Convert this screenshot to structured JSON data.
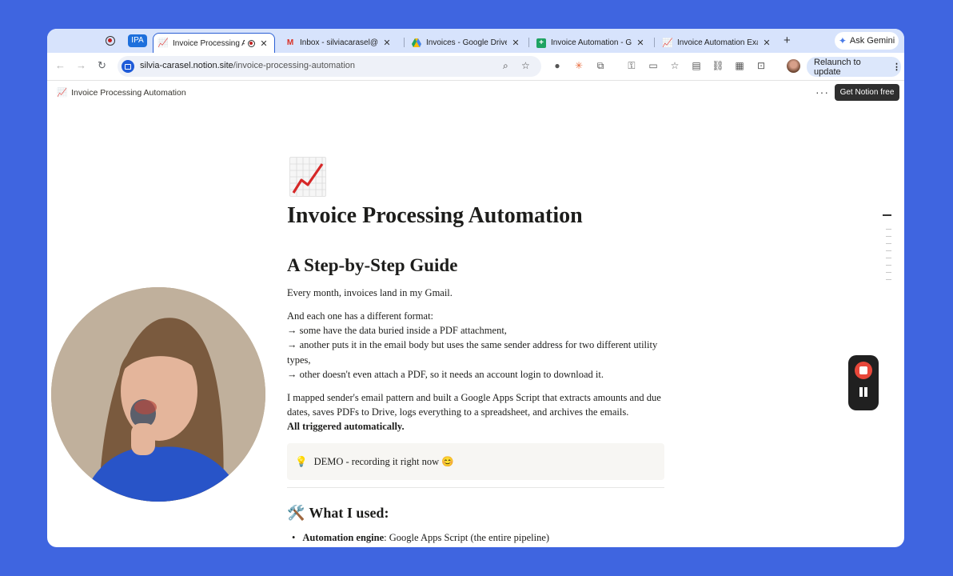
{
  "browser": {
    "group_label": "IPA",
    "tabs": [
      {
        "title": "Invoice Processing Automation",
        "active": true
      },
      {
        "title": "Inbox - silviacarasel@gmail.com"
      },
      {
        "title": "Invoices - Google Drive"
      },
      {
        "title": "Invoice Automation - Google Sheets"
      },
      {
        "title": "Invoice Automation Example"
      }
    ],
    "new_tab": "+",
    "gemini_label": "Ask Gemini",
    "url_host": "silvia-carasel.notion.site",
    "url_path": "/invoice-processing-automation",
    "relaunch_label": "Relaunch to update"
  },
  "notion": {
    "breadcrumb": "Invoice Processing Automation",
    "more": "···",
    "get_notion": "Get Notion free"
  },
  "page": {
    "title": "Invoice Processing Automation",
    "subtitle": "A Step-by-Step Guide",
    "p1": "Every month, invoices land in my Gmail.",
    "p2_lines": [
      "And each one has a different format:",
      "→ some have the data buried inside a PDF attachment,",
      "→ another puts it in the email body but uses the same sender address for two different utility",
      "types,",
      "→ other doesn't even attach a PDF, so it needs an account login to download it."
    ],
    "p3_lines": [
      "I mapped sender's email pattern and built a Google Apps Script that extracts amounts and due",
      "dates, saves PDFs to Drive, logs everything to a spreadsheet, and archives the emails."
    ],
    "p3_bold": "All triggered automatically.",
    "callout_icon": "💡",
    "callout_text": "DEMO - recording it right now 😊",
    "section_icon": "🛠️",
    "section_title": "What I used:",
    "bullets": [
      {
        "bold": "Automation engine",
        "text": ": Google Apps Script (the entire pipeline)"
      }
    ]
  },
  "icons": {
    "page_icon": "chart-increasing-icon",
    "record_stop": "stop-icon",
    "record_pause": "pause-icon"
  }
}
